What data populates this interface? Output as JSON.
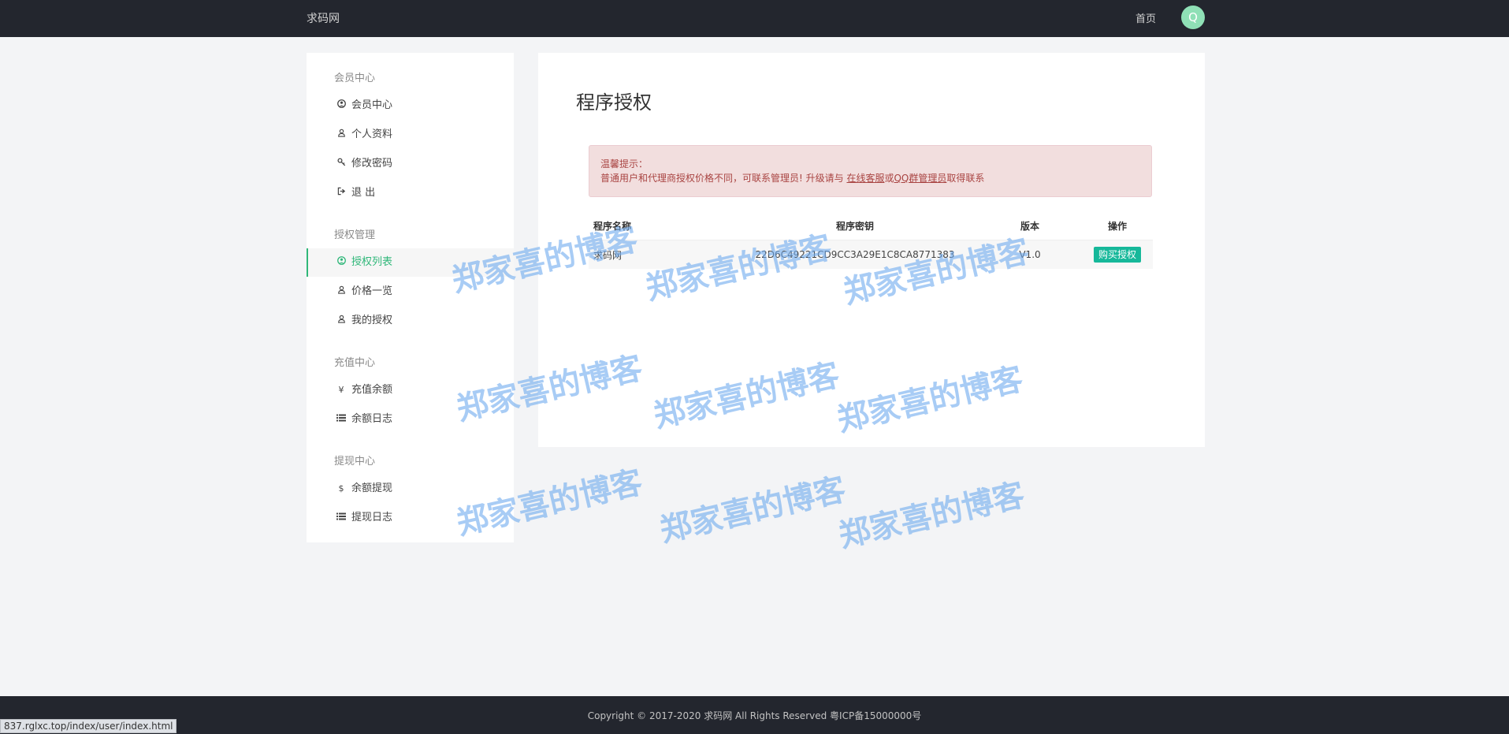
{
  "header": {
    "brand": "求码网",
    "home_label": "首页",
    "avatar_glyph": "Q"
  },
  "sidebar": {
    "groups": [
      {
        "title": "会员中心",
        "items": [
          {
            "icon": "user-circle-icon",
            "label": "会员中心"
          },
          {
            "icon": "user-icon",
            "label": "个人资料"
          },
          {
            "icon": "key-icon",
            "label": "修改密码"
          },
          {
            "icon": "sign-out-icon",
            "label": "退 出"
          }
        ]
      },
      {
        "title": "授权管理",
        "items": [
          {
            "icon": "user-circle-icon",
            "label": "授权列表",
            "active": true
          },
          {
            "icon": "user-icon",
            "label": "价格一览"
          },
          {
            "icon": "user-icon",
            "label": "我的授权"
          }
        ]
      },
      {
        "title": "充值中心",
        "items": [
          {
            "icon": "yen-icon",
            "label": "充值余额"
          },
          {
            "icon": "list-icon",
            "label": "余额日志"
          }
        ]
      },
      {
        "title": "提现中心",
        "items": [
          {
            "icon": "dollar-icon",
            "label": "余额提现"
          },
          {
            "icon": "list-icon",
            "label": "提现日志"
          }
        ]
      }
    ]
  },
  "main": {
    "title": "程序授权",
    "alert": {
      "title": "温馨提示：",
      "body_prefix": "普通用户和代理商授权价格不同，可联系管理员! 升级请与 ",
      "link1": "在线客服",
      "middle": "或",
      "link2": "QQ群管理员",
      "suffix": "取得联系"
    },
    "table": {
      "headers": {
        "name": "程序名称",
        "key": "程序密钥",
        "version": "版本",
        "action": "操作"
      },
      "rows": [
        {
          "name": "求码网",
          "key": "22D6C49221CD9CC3A29E1C8CA8771383",
          "version": "V1.0",
          "action": "购买授权"
        }
      ]
    }
  },
  "footer": {
    "copyright": "Copyright © 2017-2020 求码网 All Rights Reserved 粤ICP备15000000号"
  },
  "status_url": "837.rglxc.top/index/user/index.html",
  "watermark": "郑家喜的博客",
  "colors": {
    "topbar": "#23262e",
    "accent": "#2fb779",
    "button": "#16b89a",
    "alert_text": "#a94442",
    "alert_bg": "#f2dede"
  }
}
